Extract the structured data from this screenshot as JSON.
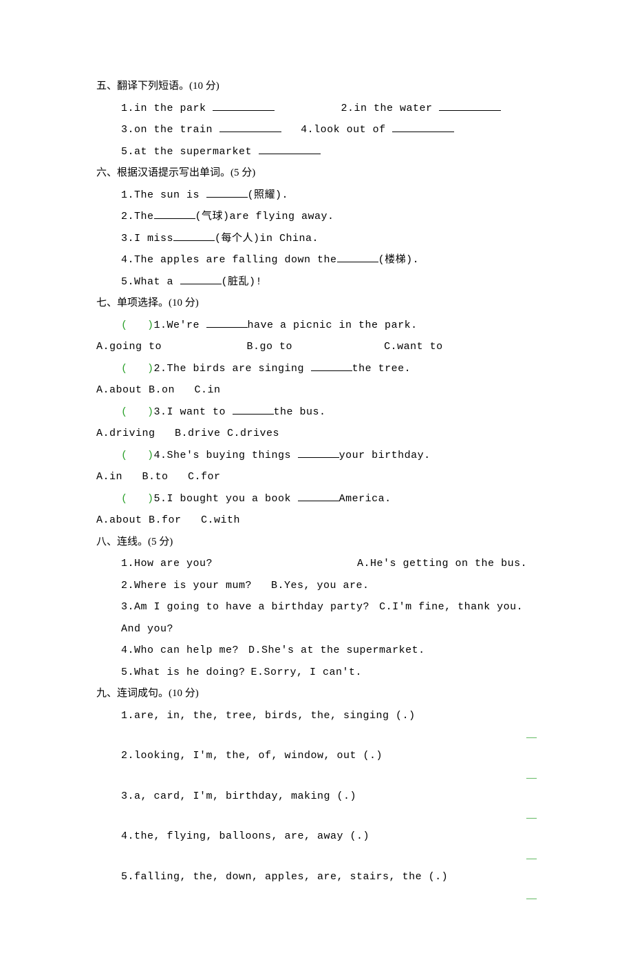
{
  "section5": {
    "heading": "五、翻译下列短语。(10 分)",
    "items": [
      "1.in the park",
      "2.in the water",
      "3.on the train",
      "4.look out of",
      "5.at the supermarket"
    ]
  },
  "section6": {
    "heading": "六、根据汉语提示写出单词。(5 分)",
    "items": [
      {
        "pre": "1.The sun is ",
        "hint": "(照耀).",
        "post": ""
      },
      {
        "pre": "2.The",
        "hint": "(气球)are flying away.",
        "post": ""
      },
      {
        "pre": "3.I miss",
        "hint": "(每个人)in China.",
        "post": ""
      },
      {
        "pre": "4.The apples are falling down the",
        "hint": "(楼梯).",
        "post": ""
      },
      {
        "pre": "5.What a ",
        "hint": "(脏乱)!",
        "post": ""
      }
    ]
  },
  "section7": {
    "heading": "七、单项选择。(10 分)",
    "items": [
      {
        "q": "1.We're ",
        "qend": "have a picnic in the park.",
        "opts": "A.going to             B.go to              C.want to"
      },
      {
        "q": "2.The birds are singing ",
        "qend": "the tree.",
        "opts": "A.about B.on   C.in"
      },
      {
        "q": "3.I want to ",
        "qend": "the bus.",
        "opts": "A.driving   B.drive C.drives"
      },
      {
        "q": "4.She's buying things ",
        "qend": "your birthday.",
        "opts": "A.in   B.to   C.for"
      },
      {
        "q": "5.I bought you a book ",
        "qend": "America.",
        "opts": "A.about B.for   C.with"
      }
    ]
  },
  "section8": {
    "heading": "八、连线。(5 分)",
    "items": [
      {
        "l": "1.How are you?",
        "r": "A.He's getting on the bus."
      },
      {
        "l": "2.Where is your mum?",
        "r": "B.Yes, you are."
      },
      {
        "l": "3.Am I going to have a birthday party?",
        "r": "C.I'm fine, thank you. And you?"
      },
      {
        "l": "4.Who can help me?",
        "r": "D.She's at the supermarket."
      },
      {
        "l": "5.What is he doing?",
        "r": "E.Sorry, I can't."
      }
    ],
    "gaps": [
      210,
      28,
      14,
      14,
      8
    ]
  },
  "section9": {
    "heading": "九、连词成句。(10 分)",
    "items": [
      "1.are, in, the, tree, birds, the, singing (.)",
      "2.looking, I'm, the, of, window, out (.)",
      "3.a, card, I'm, birthday, making (.)",
      "4.the, flying, balloons, are, away (.)",
      "5.falling, the, down, apples, are, stairs, the (.)"
    ],
    "dash": "—"
  }
}
